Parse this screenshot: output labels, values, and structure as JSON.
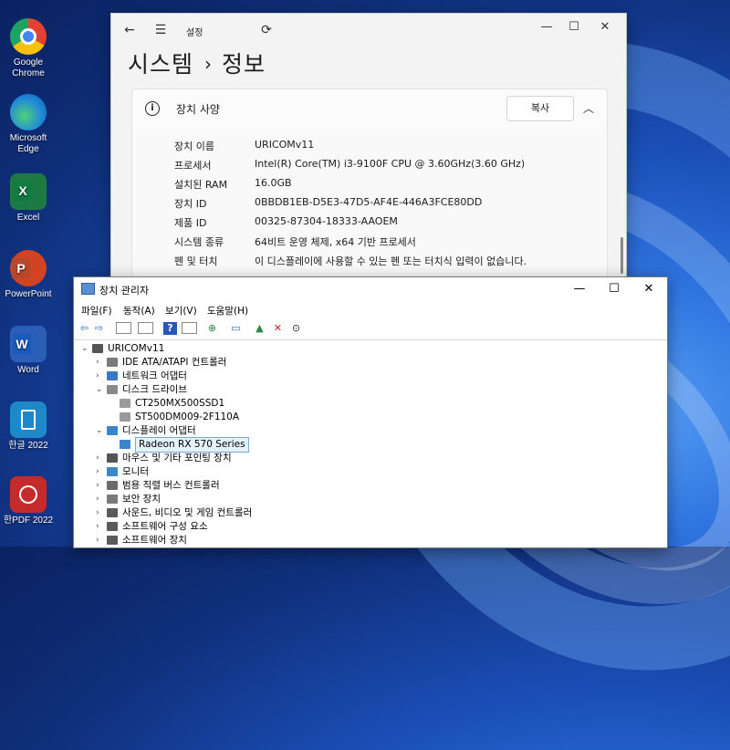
{
  "desktop": {
    "icons": [
      {
        "label": "Google Chrome",
        "color": "#e34133"
      },
      {
        "label": "Microsoft Edge",
        "color": "#1f8ad8"
      },
      {
        "label": "Excel",
        "color": "#1d7a43"
      },
      {
        "label": "PowerPoint",
        "color": "#d04423"
      },
      {
        "label": "Word",
        "color": "#2b5eb8"
      },
      {
        "label": "한글 2022",
        "color": "#1e88c8"
      },
      {
        "label": "한PDF 2022",
        "color": "#c62b2b"
      }
    ]
  },
  "settings": {
    "app_title": "설정",
    "breadcrumb_parent": "시스템",
    "breadcrumb_sep": "›",
    "breadcrumb_current": "정보",
    "card_title": "장치 사양",
    "copy_label": "복사",
    "specs": [
      {
        "key": "장치 이름",
        "value": "URICOMv11"
      },
      {
        "key": "프로세서",
        "value": "Intel(R) Core(TM) i3-9100F CPU @ 3.60GHz(3.60 GHz)"
      },
      {
        "key": "설치된 RAM",
        "value": "16.0GB"
      },
      {
        "key": "장치 ID",
        "value": "0BBDB1EB-D5E3-47D5-AF4E-446A3FCE80DD"
      },
      {
        "key": "제품 ID",
        "value": "00325-87304-18333-AAOEM"
      },
      {
        "key": "시스템 종류",
        "value": "64비트 운영 체제, x64 기반 프로세서"
      },
      {
        "key": "펜 및 터치",
        "value": "이 디스플레이에 사용할 수 있는 펜 또는 터치식 입력이 없습니다."
      }
    ]
  },
  "device_manager": {
    "title": "장치 관리자",
    "menu": [
      "파일(F)",
      "동작(A)",
      "보기(V)",
      "도움말(H)"
    ],
    "root": "URICOMv11",
    "tree": [
      {
        "label": "IDE ATA/ATAPI 컨트롤러",
        "level": 1,
        "expander": "›",
        "icon_color": "#7a7a7a"
      },
      {
        "label": "네트워크 어댑터",
        "level": 1,
        "expander": "›",
        "icon_color": "#3a78c4"
      },
      {
        "label": "디스크 드라이브",
        "level": 1,
        "expander": "⌄",
        "icon_color": "#8a8a8a"
      },
      {
        "label": "CT250MX500SSD1",
        "level": 2,
        "expander": "",
        "icon_color": "#9a9a9a"
      },
      {
        "label": "ST500DM009-2F110A",
        "level": 2,
        "expander": "",
        "icon_color": "#9a9a9a"
      },
      {
        "label": "디스플레이 어댑터",
        "level": 1,
        "expander": "⌄",
        "icon_color": "#3a86c8"
      },
      {
        "label": "Radeon RX 570 Series",
        "level": 2,
        "expander": "",
        "icon_color": "#3a86c8",
        "selected": true
      },
      {
        "label": "마우스 및 기타 포인팅 장치",
        "level": 1,
        "expander": "›",
        "icon_color": "#555555"
      },
      {
        "label": "모니터",
        "level": 1,
        "expander": "›",
        "icon_color": "#3a86c8"
      },
      {
        "label": "범용 직렬 버스 컨트롤러",
        "level": 1,
        "expander": "›",
        "icon_color": "#6b6b6b"
      },
      {
        "label": "보안 장치",
        "level": 1,
        "expander": "›",
        "icon_color": "#7a7a7a"
      },
      {
        "label": "사운드, 비디오 및 게임 컨트롤러",
        "level": 1,
        "expander": "›",
        "icon_color": "#5a5a5a"
      },
      {
        "label": "소프트웨어 구성 요소",
        "level": 1,
        "expander": "›",
        "icon_color": "#5a5a5a"
      },
      {
        "label": "소프트웨어 장치",
        "level": 1,
        "expander": "›",
        "icon_color": "#5a5a5a"
      }
    ]
  }
}
